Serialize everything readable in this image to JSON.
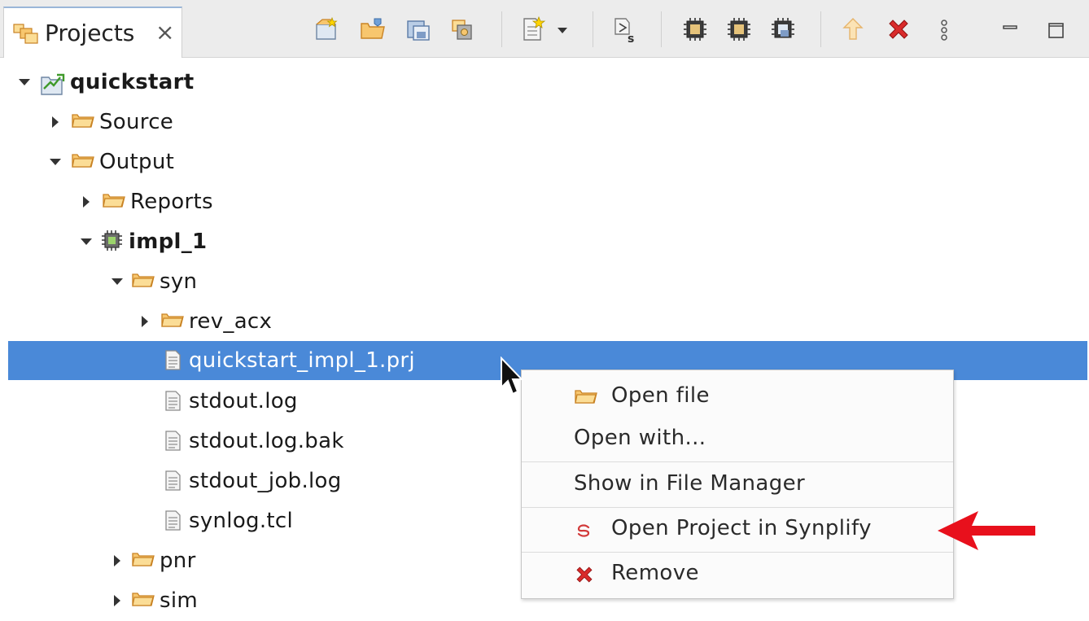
{
  "tab": {
    "label": "Projects",
    "close": "×"
  },
  "toolbar": {
    "icons": [
      "new-project-icon",
      "open-project-icon",
      "save-project-icon",
      "project-properties-icon",
      "new-file-icon",
      "dropdown-arrow-icon",
      "script-icon",
      "chip-icon",
      "chip-run-icon",
      "chip-save-icon",
      "up-arrow-icon",
      "delete-icon",
      "view-menu-icon",
      "minimize-icon",
      "maximize-icon"
    ]
  },
  "tree": {
    "items": [
      {
        "label": "quickstart",
        "icon": "project-icon",
        "expanded": true
      },
      {
        "label": "Source",
        "icon": "folder-icon",
        "expanded": false
      },
      {
        "label": "Output",
        "icon": "folder-icon",
        "expanded": true
      },
      {
        "label": "Reports",
        "icon": "folder-icon",
        "expanded": false
      },
      {
        "label": "impl_1",
        "icon": "chip-icon",
        "expanded": true
      },
      {
        "label": "syn",
        "icon": "folder-icon",
        "expanded": true
      },
      {
        "label": "rev_acx",
        "icon": "folder-icon",
        "expanded": false
      },
      {
        "label": "quickstart_impl_1.prj",
        "icon": "file-icon",
        "selected": true
      },
      {
        "label": "stdout.log",
        "icon": "file-icon"
      },
      {
        "label": "stdout.log.bak",
        "icon": "file-icon"
      },
      {
        "label": "stdout_job.log",
        "icon": "file-icon"
      },
      {
        "label": "synlog.tcl",
        "icon": "file-icon"
      },
      {
        "label": "pnr",
        "icon": "folder-icon",
        "expanded": false
      },
      {
        "label": "sim",
        "icon": "folder-icon",
        "expanded": false
      }
    ]
  },
  "context_menu": {
    "open_file": "Open file",
    "open_with": "Open with...",
    "show_in_file_manager": "Show in File Manager",
    "open_in_synplify": "Open Project in Synplify",
    "remove": "Remove"
  },
  "colors": {
    "selection": "#4a89d8",
    "folder": "#f0a640",
    "annotation_arrow": "#e8101c",
    "delete_red": "#d92b2b"
  }
}
